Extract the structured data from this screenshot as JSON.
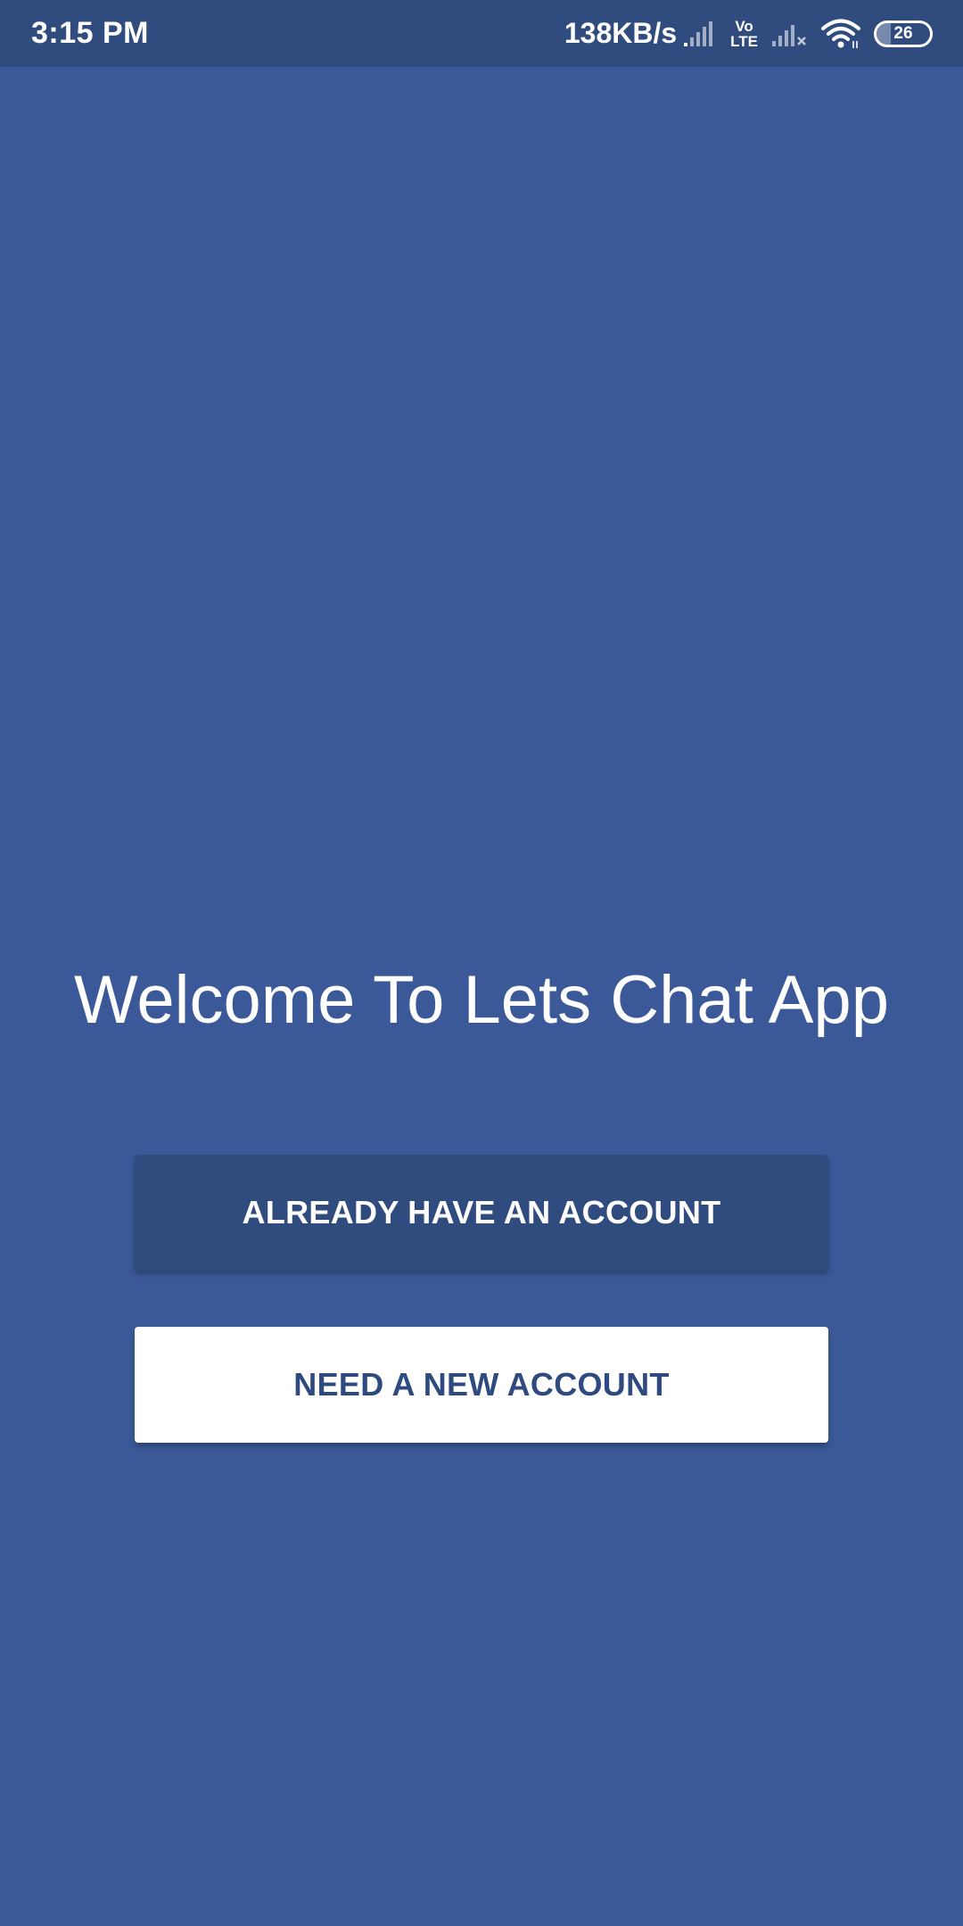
{
  "status_bar": {
    "time": "3:15 PM",
    "net_speed": "138KB/s",
    "volte_top": "Vo",
    "volte_bottom": "LTE",
    "battery_level": "26",
    "battery_fraction": 0.26,
    "icons": [
      "signal-icon",
      "volte-icon",
      "signal-no-service-icon",
      "wifi-icon",
      "battery-icon"
    ]
  },
  "main": {
    "welcome_title": "Welcome To Lets Chat App",
    "login_button_label": "ALREADY HAVE AN ACCOUNT",
    "register_button_label": "NEED A NEW ACCOUNT"
  },
  "colors": {
    "background": "#3b5998",
    "status_bar": "#304c7e",
    "primary_button": "#304c7e",
    "secondary_button": "#ffffff",
    "secondary_button_text": "#2f4a7e"
  }
}
